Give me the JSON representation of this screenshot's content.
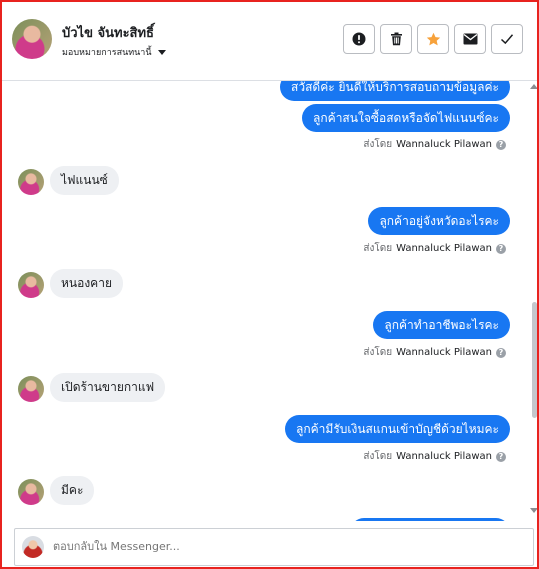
{
  "header": {
    "name": "บัวไข จันทะสิทธิ์",
    "assign_label": "มอบหมายการสนทนานี้",
    "actions": [
      "spam",
      "delete",
      "star",
      "mark-unread",
      "done"
    ]
  },
  "messages": {
    "m0": "สวัสดีค่ะ ยินดีให้บริการสอบถามข้อมูลค่ะ",
    "m1": "ลูกค้าสนใจซื้อสดหรือจัดไฟแนนซ์คะ",
    "m2": "ไฟแนนซ์",
    "m3": "ลูกค้าอยู่จังหวัดอะไรคะ",
    "m4": "หนองคาย",
    "m5": "ลูกค้าทำอาชีพอะไรคะ",
    "m6": "เปิดร้านขายกาแฟ",
    "m7": "ลูกค้ามีรับเงินสแกนเข้าบัญชีด้วยไหมคะ",
    "m8": "มีคะ"
  },
  "sentby": {
    "prefix": "ส่งโดย",
    "agent": "Wannaluck Pilawan",
    "help": "?"
  },
  "composer": {
    "placeholder": "ตอบกลับใน Messenger..."
  },
  "colors": {
    "border": "#e8231f",
    "accent": "#1877f2",
    "incoming_bg": "#eef0f3",
    "star": "#f7a23b"
  }
}
